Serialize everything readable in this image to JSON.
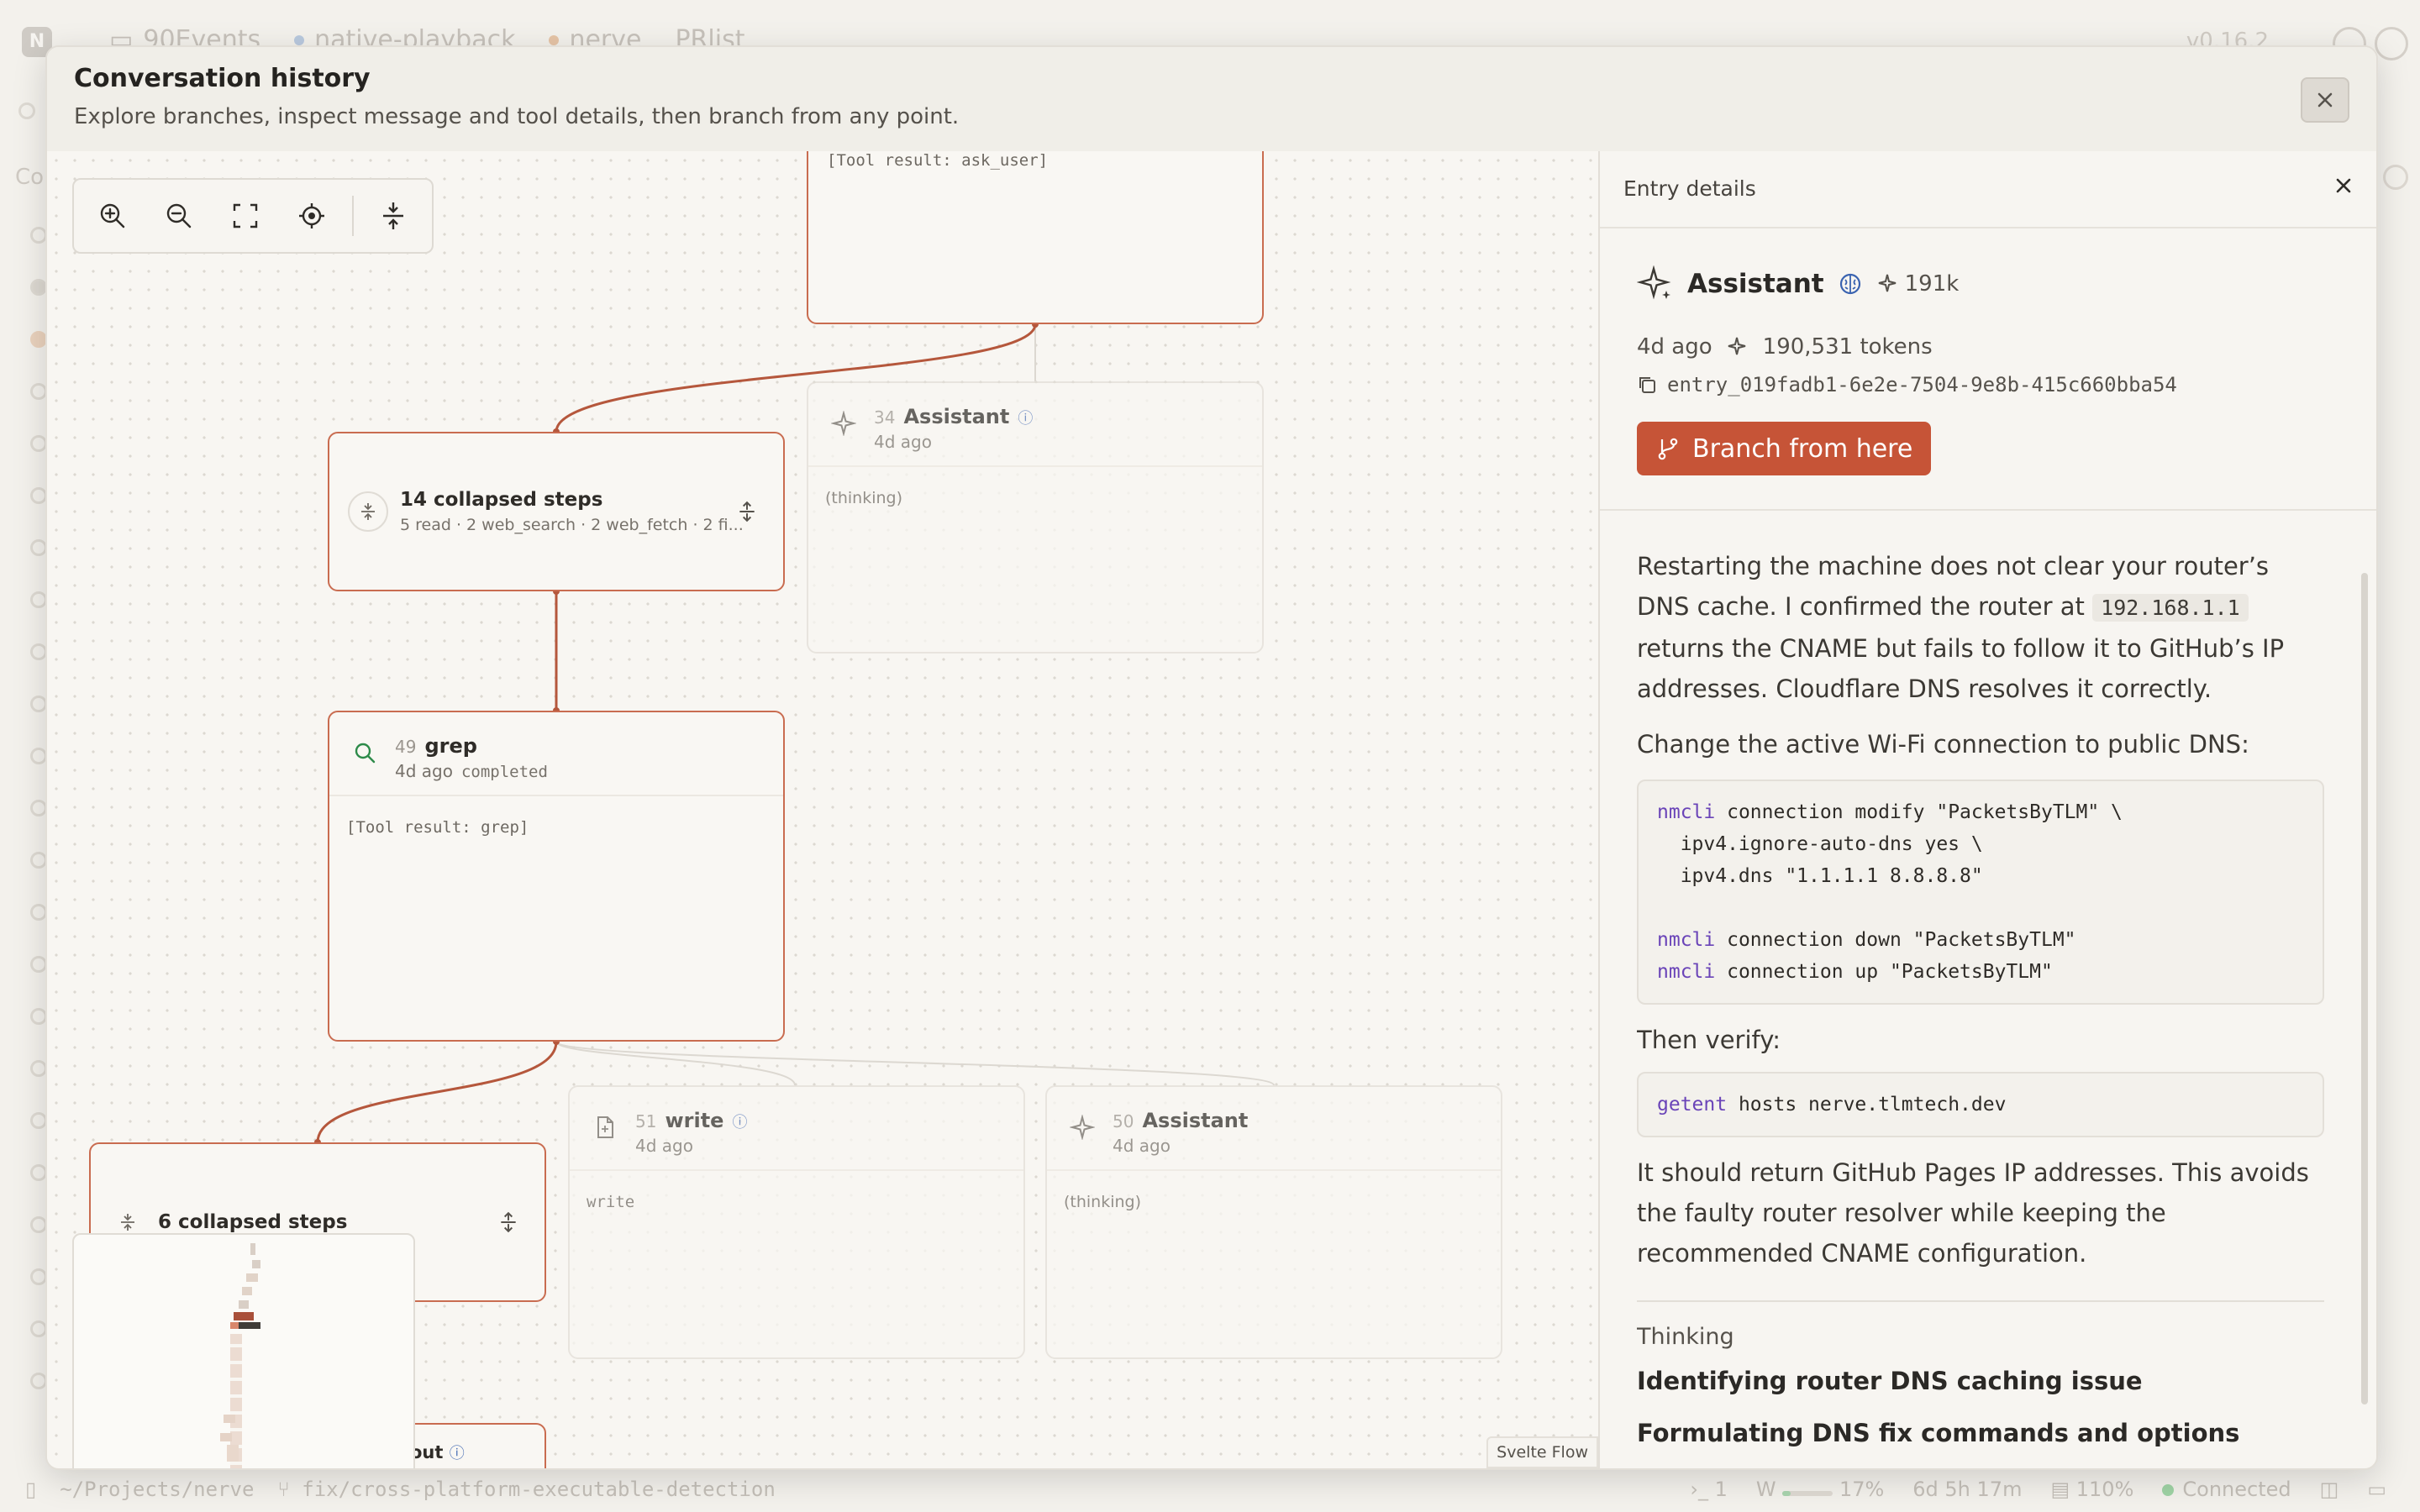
{
  "background": {
    "tabs": [
      "90Events",
      "native-playback",
      "nerve",
      "PRlist"
    ],
    "version": "v0.16.2",
    "sidebar_label": "Co",
    "statusbar": {
      "path": "~/Projects/nerve",
      "branch": "fix/cross-platform-executable-detection",
      "count": "1",
      "workspace": "W",
      "usage_pct": "17%",
      "uptime": "6d 5h 17m",
      "zoom": "110%",
      "connection": "Connected"
    }
  },
  "modal": {
    "title": "Conversation history",
    "subtitle": "Explore branches, inspect message and tool details, then branch from any point."
  },
  "canvas": {
    "toolbar": [
      "zoom-in",
      "zoom-out",
      "fit-view",
      "center",
      "expand-all"
    ],
    "attribution": "Svelte Flow",
    "nodes": {
      "ask_user": {
        "body": "[Tool result: ask_user]"
      },
      "assistant34": {
        "index": "34",
        "title": "Assistant",
        "time": "4d ago",
        "body": "(thinking)"
      },
      "collapsed14": {
        "title": "14 collapsed steps",
        "summary": "5 read · 2 web_search · 2 web_fetch · 2 fi..."
      },
      "grep49": {
        "index": "49",
        "title": "grep",
        "time": "4d ago",
        "status": "completed",
        "body": "[Tool result: grep]"
      },
      "collapsed6": {
        "title": "6 collapsed steps"
      },
      "write51": {
        "index": "51",
        "title": "write",
        "time": "4d ago",
        "body": "write"
      },
      "assistant50": {
        "index": "50",
        "title": "Assistant",
        "time": "4d ago",
        "body": "(thinking)"
      },
      "partial": {
        "title_fragment": "out"
      }
    }
  },
  "details": {
    "title": "Entry details",
    "role": "Assistant",
    "tokens_short": "191k",
    "time": "4d ago",
    "tokens": "190,531 tokens",
    "entry_id": "entry_019fadb1-6e2e-7504-9e8b-415c660bba54",
    "branch_label": "Branch from here",
    "content": {
      "p1_a": "Restarting the machine does not clear your router’s DNS cache. I confirmed the router at",
      "p1_code": "192.168.1.1",
      "p1_b": "returns the CNAME but fails to follow it to GitHub’s IP addresses. Cloudflare DNS resolves it correctly.",
      "p2": "Change the active Wi-Fi connection to public DNS:",
      "code1": [
        {
          "cmd": "nmcli",
          "rest": " connection modify \"PacketsByTLM\" \\"
        },
        {
          "cmd": "",
          "rest": "  ipv4.ignore-auto-dns yes \\"
        },
        {
          "cmd": "",
          "rest": "  ipv4.dns \"1.1.1.1 8.8.8.8\""
        },
        {
          "cmd": "",
          "rest": " "
        },
        {
          "cmd": "nmcli",
          "rest": " connection down \"PacketsByTLM\""
        },
        {
          "cmd": "nmcli",
          "rest": " connection up \"PacketsByTLM\""
        }
      ],
      "p3": "Then verify:",
      "code2_cmd": "getent",
      "code2_rest": " hosts nerve.tlmtech.dev",
      "p4": "It should return GitHub Pages IP addresses. This avoids the faulty router resolver while keeping the recommended CNAME configuration.",
      "thinking_label": "Thinking",
      "thinking_items": [
        "Identifying router DNS caching issue",
        "Formulating DNS fix commands and options"
      ]
    }
  },
  "colors": {
    "accent": "#c65437",
    "edge": "#b5573c",
    "edge_dim": "#dcd8d1",
    "command": "#6a44b8",
    "connected": "#9fd3a5"
  }
}
